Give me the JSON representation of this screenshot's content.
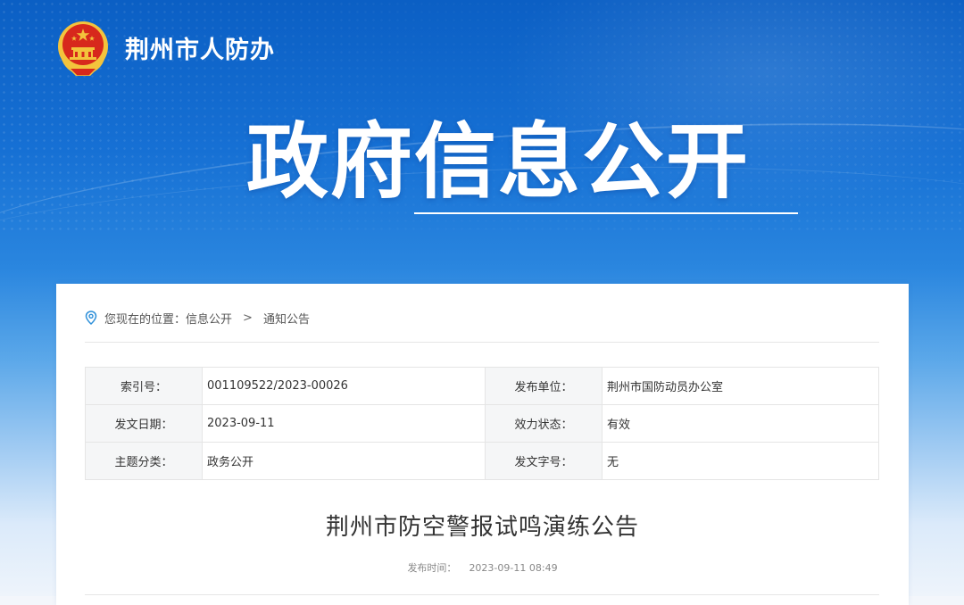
{
  "header": {
    "site_name": "荆州市人防办",
    "hero_title": "政府信息公开"
  },
  "breadcrumb": {
    "prefix": "您现在的位置：",
    "items": [
      "信息公开",
      "通知公告"
    ],
    "separator": ">"
  },
  "meta": {
    "rows": [
      {
        "k1": "索引号：",
        "v1": "001109522/2023-00026",
        "k2": "发布单位：",
        "v2": "荆州市国防动员办公室"
      },
      {
        "k1": "发文日期：",
        "v1": "2023-09-11",
        "k2": "效力状态：",
        "v2": "有效"
      },
      {
        "k1": "主题分类：",
        "v1": "政务公开",
        "k2": "发文字号：",
        "v2": "无"
      }
    ]
  },
  "article": {
    "title": "荆州市防空警报试鸣演练公告",
    "pub_label": "发布时间：",
    "pub_time": "2023-09-11 08:49"
  },
  "icons": {
    "emblem": "national-emblem-icon",
    "location": "location-pin-icon"
  },
  "colors": {
    "banner_top": "#0b5fc4",
    "emblem_red": "#d7281c",
    "emblem_gold": "#f3c33c",
    "pin_blue": "#2d8fd9"
  }
}
